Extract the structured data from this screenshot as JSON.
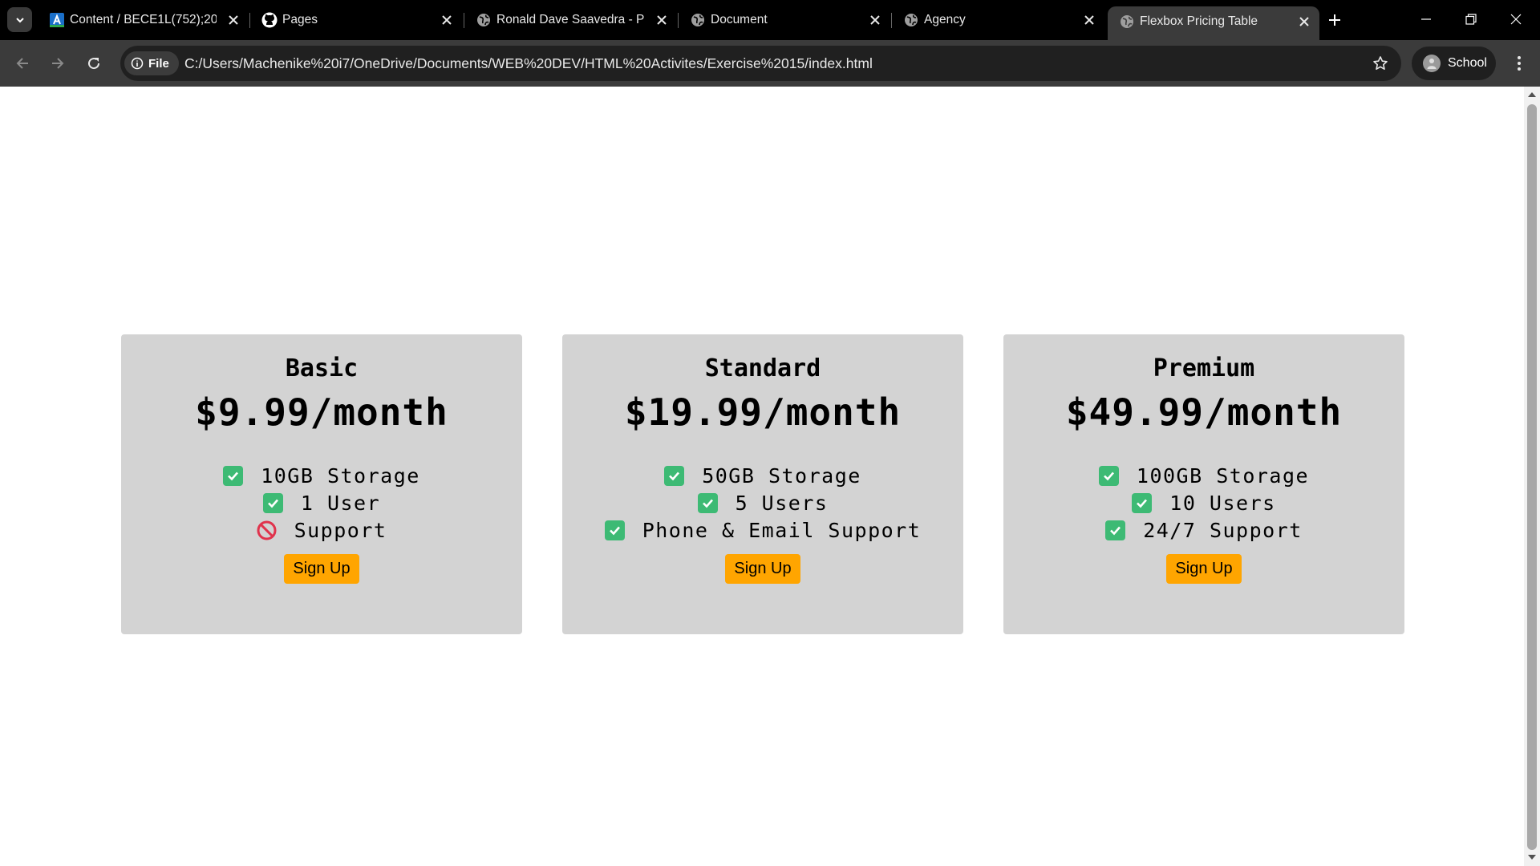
{
  "browser": {
    "tabs": [
      {
        "title": "Content / BECE1L(752);202",
        "icon": "atom-icon",
        "active": false
      },
      {
        "title": "Pages",
        "icon": "github-icon",
        "active": false
      },
      {
        "title": "Ronald Dave Saavedra - Po",
        "icon": "globe-icon",
        "active": false
      },
      {
        "title": "Document",
        "icon": "globe-icon",
        "active": false
      },
      {
        "title": "Agency",
        "icon": "globe-icon",
        "active": false
      },
      {
        "title": "Flexbox Pricing Table",
        "icon": "globe-icon",
        "active": true
      }
    ],
    "site_chip": "File",
    "url": "C:/Users/Machenike%20i7/OneDrive/Documents/WEB%20DEV/HTML%20Activites/Exercise%2015/index.html",
    "profile_name": "School"
  },
  "plans": [
    {
      "name": "Basic",
      "price": "$9.99/month",
      "features": [
        {
          "text": "10GB Storage",
          "included": true
        },
        {
          "text": "1 User",
          "included": true
        },
        {
          "text": "Support",
          "included": false
        }
      ],
      "button": "Sign Up"
    },
    {
      "name": "Standard",
      "price": "$19.99/month",
      "features": [
        {
          "text": "50GB Storage",
          "included": true
        },
        {
          "text": "5 Users",
          "included": true
        },
        {
          "text": "Phone & Email Support",
          "included": true
        }
      ],
      "button": "Sign Up"
    },
    {
      "name": "Premium",
      "price": "$49.99/month",
      "features": [
        {
          "text": "100GB Storage",
          "included": true
        },
        {
          "text": "10 Users",
          "included": true
        },
        {
          "text": "24/7 Support",
          "included": true
        }
      ],
      "button": "Sign Up"
    }
  ],
  "colors": {
    "card_bg": "#d3d3d3",
    "button_bg": "#ffa500",
    "check_green": "#3dba74",
    "prohibited_red": "#e0334c"
  }
}
